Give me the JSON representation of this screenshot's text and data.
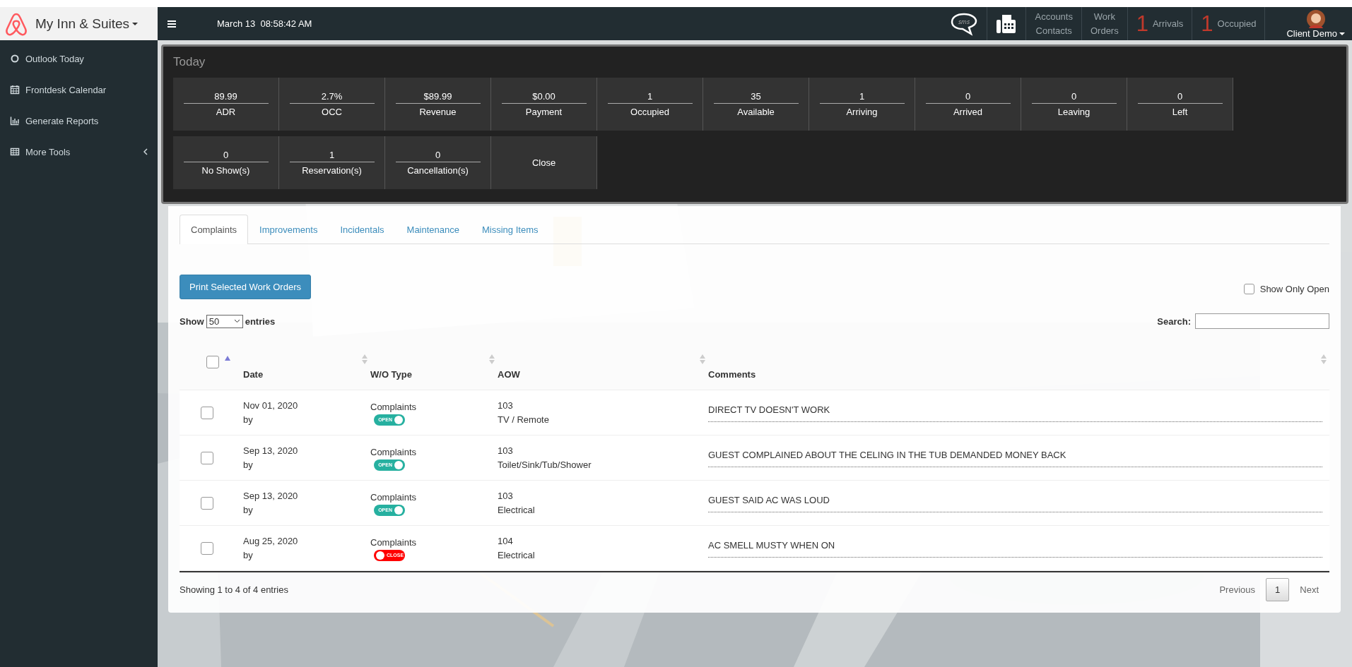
{
  "brand": {
    "name": "My Inn & Suites"
  },
  "topbar": {
    "datetime": "March 13  08:58:42 AM",
    "sms_label": "sms",
    "links": [
      {
        "lines": [
          "Accounts",
          "Contacts"
        ]
      },
      {
        "lines": [
          "Work",
          "Orders"
        ]
      }
    ],
    "counters": [
      {
        "count": "1",
        "label": "Arrivals"
      },
      {
        "count": "1",
        "label": "Occupied"
      }
    ],
    "user": "Client Demo"
  },
  "sidebar": {
    "items": [
      {
        "label": "Outlook Today",
        "expandable": false
      },
      {
        "label": "Frontdesk Calendar",
        "expandable": false
      },
      {
        "label": "Generate Reports",
        "expandable": false
      },
      {
        "label": "More Tools",
        "expandable": true
      }
    ]
  },
  "today": {
    "title": "Today",
    "rows": [
      [
        {
          "value": "89.99",
          "label": "ADR"
        },
        {
          "value": "2.7%",
          "label": "OCC"
        },
        {
          "value": "$89.99",
          "label": "Revenue"
        },
        {
          "value": "$0.00",
          "label": "Payment"
        },
        {
          "value": "1",
          "label": "Occupied"
        },
        {
          "value": "35",
          "label": "Available"
        },
        {
          "value": "1",
          "label": "Arriving"
        },
        {
          "value": "0",
          "label": "Arrived"
        },
        {
          "value": "0",
          "label": "Leaving"
        },
        {
          "value": "0",
          "label": "Left"
        }
      ],
      [
        {
          "value": "0",
          "label": "No Show(s)"
        },
        {
          "value": "1",
          "label": "Reservation(s)"
        },
        {
          "value": "0",
          "label": "Cancellation(s)"
        },
        {
          "label": "Close"
        }
      ]
    ]
  },
  "tabs": [
    {
      "label": "Complaints",
      "selected": true
    },
    {
      "label": "Improvements",
      "selected": false
    },
    {
      "label": "Incidentals",
      "selected": false
    },
    {
      "label": "Maintenance",
      "selected": false
    },
    {
      "label": "Missing Items",
      "selected": false
    }
  ],
  "print_button": "Print Selected Work Orders",
  "show_only_open": {
    "label": "Show Only Open",
    "checked": false
  },
  "length": {
    "show": "Show",
    "value": "50",
    "entries": "entries"
  },
  "search": {
    "label": "Search:"
  },
  "table": {
    "select_all_checked": false,
    "columns": [
      "Date",
      "W/O Type",
      "AOW",
      "Comments"
    ],
    "rows": [
      {
        "checked": false,
        "date": "Nov 01, 2020",
        "by": "by",
        "type": "Complaints",
        "open": true,
        "status": "OPEN",
        "room": "103",
        "area": "TV / Remote",
        "comment": "DIRECT TV DOESN'T WORK"
      },
      {
        "checked": false,
        "date": "Sep 13, 2020",
        "by": "by",
        "type": "Complaints",
        "open": true,
        "status": "OPEN",
        "room": "103",
        "area": "Toilet/Sink/Tub/Shower",
        "comment": "GUEST COMPLAINED ABOUT THE CELING IN THE TUB DEMANDED MONEY BACK"
      },
      {
        "checked": false,
        "date": "Sep 13, 2020",
        "by": "by",
        "type": "Complaints",
        "open": true,
        "status": "OPEN",
        "room": "103",
        "area": "Electrical",
        "comment": "GUEST SAID AC WAS LOUD"
      },
      {
        "checked": false,
        "date": "Aug 25, 2020",
        "by": "by",
        "type": "Complaints",
        "open": false,
        "status": "CLOSE",
        "room": "104",
        "area": "Electrical",
        "comment": "AC SMELL MUSTY WHEN ON"
      }
    ]
  },
  "info": "Showing 1 to 4 of 4 entries",
  "pagination": {
    "previous": {
      "label": "Previous",
      "disabled": true
    },
    "pages": [
      {
        "label": "1",
        "selected": true
      }
    ],
    "next": {
      "label": "Next",
      "disabled": true
    }
  }
}
